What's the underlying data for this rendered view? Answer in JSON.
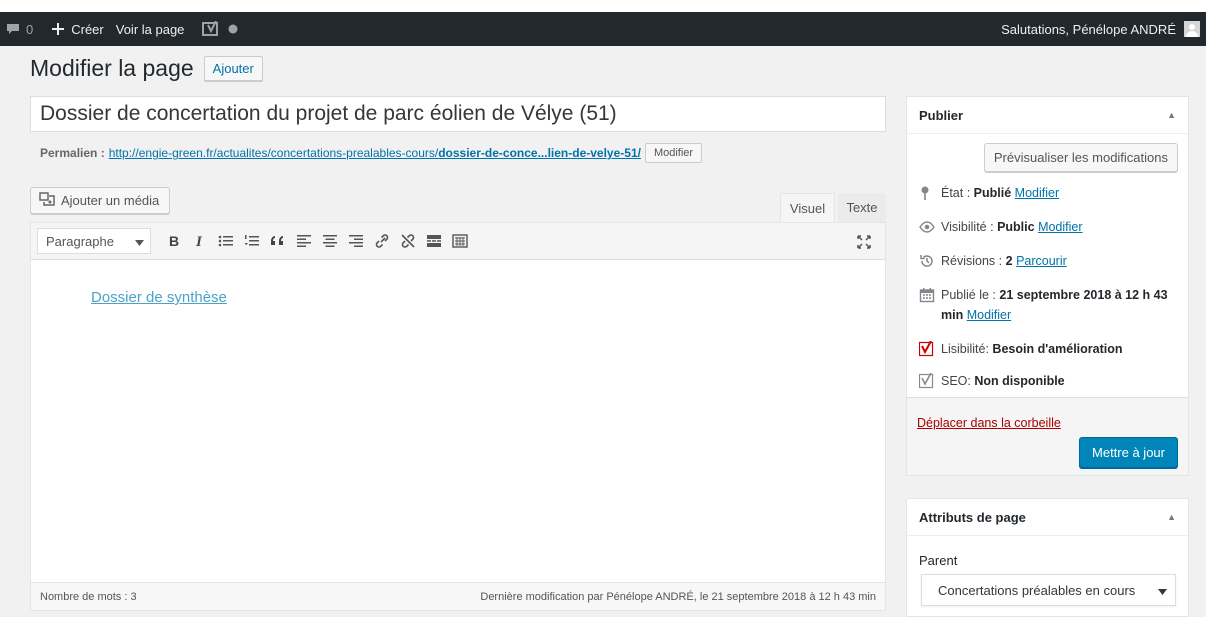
{
  "adminbar": {
    "comments_count": "0",
    "create_label": "Créer",
    "view_label": "Voir la page",
    "greeting": "Salutations, Pénélope ANDRÉ"
  },
  "header": {
    "title": "Modifier la page",
    "add_label": "Ajouter"
  },
  "post": {
    "title": "Dossier de concertation du projet de parc éolien de Vélye (51)",
    "permalink_label": "Permalien :",
    "permalink_base": "http://engie-green.fr/actualites/concertations-prealables-cours/",
    "permalink_slug": "dossier-de-conce...lien-de-velye-51/",
    "permalink_edit_label": "Modifier"
  },
  "editor": {
    "add_media_label": "Ajouter un média",
    "tab_visual": "Visuel",
    "tab_text": "Texte",
    "format_select": "Paragraphe",
    "content_link": "Dossier de synthèse",
    "word_count": "Nombre de mots : 3",
    "last_modified": "Dernière modification par Pénélope ANDRÉ, le 21 septembre 2018 à 12 h 43 min"
  },
  "publish": {
    "title": "Publier",
    "preview_label": "Prévisualiser les modifications",
    "status_label": "État :",
    "status_value": "Publié",
    "visibility_label": "Visibilité :",
    "visibility_value": "Public",
    "revisions_label": "Révisions :",
    "revisions_value": "2",
    "browse_label": "Parcourir",
    "published_label": "Publié le :",
    "published_value": "21 septembre 2018 à 12 h 43 min",
    "edit_label": "Modifier",
    "readability_label": "Lisibilité:",
    "readability_value": "Besoin d'amélioration",
    "seo_label": "SEO:",
    "seo_value": "Non disponible",
    "trash_label": "Déplacer dans la corbeille",
    "update_label": "Mettre à jour"
  },
  "attributes": {
    "title": "Attributs de page",
    "parent_label": "Parent",
    "parent_value": "Concertations préalables en cours"
  },
  "colors": {
    "adminbar": "#23282d",
    "primary_button": "#0085ba",
    "link": "#0073aa",
    "trash_link": "#a00000",
    "readability_bad": "#cc0000"
  },
  "icons": [
    "comment-icon",
    "plus-icon",
    "yoast-icon",
    "status-dot-icon",
    "avatar-icon",
    "media-icon",
    "bold-icon",
    "italic-icon",
    "bullet-list-icon",
    "numbered-list-icon",
    "blockquote-icon",
    "align-left-icon",
    "align-center-icon",
    "align-right-icon",
    "link-icon",
    "unlink-icon",
    "read-more-icon",
    "toolbar-toggle-icon",
    "fullscreen-icon",
    "pin-icon",
    "eye-icon",
    "history-icon",
    "calendar-icon",
    "yoast-readability-icon",
    "yoast-seo-icon"
  ]
}
